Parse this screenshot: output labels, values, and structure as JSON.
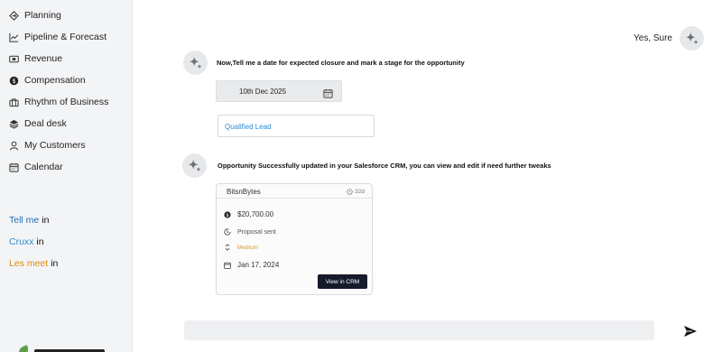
{
  "sidebar": {
    "items": [
      {
        "label": "Planning",
        "icon": "planning-icon"
      },
      {
        "label": "Pipeline & Forecast",
        "icon": "trend-line-icon"
      },
      {
        "label": "Revenue",
        "icon": "cash-icon"
      },
      {
        "label": "Compensation",
        "icon": "dollar-circle-icon"
      },
      {
        "label": "Rhythm of Business",
        "icon": "briefcase-icon"
      },
      {
        "label": "Deal desk",
        "icon": "layers-icon"
      },
      {
        "label": "My Customers",
        "icon": "user-icon"
      },
      {
        "label": "Calendar",
        "icon": "calendar-icon"
      }
    ],
    "threads": [
      {
        "key": "Tell me",
        "suffix": "in",
        "color": "#1f6fb5"
      },
      {
        "key": "Cruxx",
        "suffix": "in",
        "color": "#2a8fc8"
      },
      {
        "key": "Les meet",
        "suffix": "in",
        "color": "#d98c17"
      }
    ]
  },
  "chat": {
    "user_message": "Yes, Sure",
    "bot_prompt": "Now,Tell me a date for expected closure and mark a stage for the opportunity",
    "date_value": "10th Dec 2025",
    "stage_value": "Qualified Lead",
    "bot_confirm": "Opportunity Successfully updated in your Salesforce CRM, you can view and edit if need further tweaks",
    "card": {
      "name": "BitsnBytes",
      "age": "32d",
      "amount": "$20,700.00",
      "stage": "Proposal sent",
      "priority": "Medium",
      "close_date": "Jan 17, 2024",
      "button_label": "View in CRM"
    },
    "composer_placeholder": ""
  },
  "colors": {
    "accent_blue": "#2b8bd6",
    "priority_medium": "#e39a1b",
    "button_dark": "#161b2c"
  }
}
